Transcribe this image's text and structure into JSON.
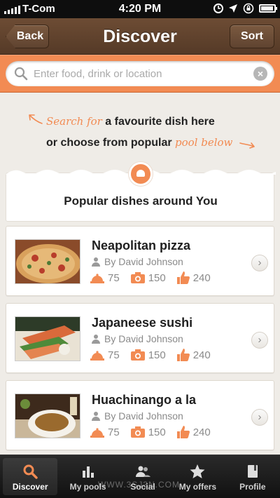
{
  "status_bar": {
    "carrier": "T-Com",
    "time": "4:20 PM"
  },
  "nav": {
    "back_label": "Back",
    "title": "Discover",
    "sort_label": "Sort"
  },
  "search": {
    "placeholder": "Enter food, drink or location",
    "value": ""
  },
  "hint": {
    "line1_hand": "Search for",
    "line1_text": " a favourite dish here",
    "line2_text": "or choose from popular ",
    "line2_hand": "pool below"
  },
  "popular": {
    "title": "Popular dishes around You"
  },
  "dishes": [
    {
      "name": "Neapolitan pizza",
      "author": "By David Johnson",
      "rating": "75",
      "photos": "150",
      "likes": "240"
    },
    {
      "name": "Japaneese sushi",
      "author": "By David Johnson",
      "rating": "75",
      "photos": "150",
      "likes": "240"
    },
    {
      "name": "Huachinango a la",
      "author": "By David Johnson",
      "rating": "75",
      "photos": "150",
      "likes": "240"
    }
  ],
  "tabs": [
    {
      "label": "Discover",
      "icon": "search-icon",
      "active": true
    },
    {
      "label": "My pools",
      "icon": "bar-chart-icon",
      "active": false
    },
    {
      "label": "Social",
      "icon": "people-icon",
      "active": false
    },
    {
      "label": "My offers",
      "icon": "star-icon",
      "active": false
    },
    {
      "label": "Profile",
      "icon": "book-icon",
      "active": false
    }
  ],
  "watermark": "WWW.3SJ3N.COM",
  "colors": {
    "accent": "#f28b53",
    "nav_brown": "#5f4330",
    "tab_bar": "#1a1a1a"
  }
}
